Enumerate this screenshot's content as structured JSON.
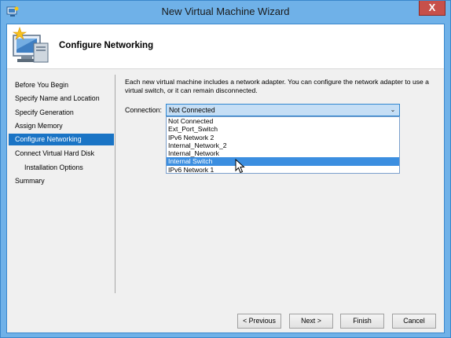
{
  "window": {
    "title": "New Virtual Machine Wizard",
    "close_glyph": "X"
  },
  "header": {
    "title": "Configure Networking",
    "icon": "virtual-machine-wizard-icon"
  },
  "nav": {
    "items": [
      {
        "label": "Before You Begin",
        "active": false,
        "sub": false
      },
      {
        "label": "Specify Name and Location",
        "active": false,
        "sub": false
      },
      {
        "label": "Specify Generation",
        "active": false,
        "sub": false
      },
      {
        "label": "Assign Memory",
        "active": false,
        "sub": false
      },
      {
        "label": "Configure Networking",
        "active": true,
        "sub": false
      },
      {
        "label": "Connect Virtual Hard Disk",
        "active": false,
        "sub": false
      },
      {
        "label": "Installation Options",
        "active": false,
        "sub": true
      },
      {
        "label": "Summary",
        "active": false,
        "sub": false
      }
    ]
  },
  "content": {
    "description": "Each new virtual machine includes a network adapter. You can configure the network adapter to use a virtual switch, or it can remain disconnected.",
    "connection_label": "Connection:",
    "connection_value": "Not Connected",
    "options": [
      {
        "label": "Not Connected",
        "selected": false
      },
      {
        "label": "Ext_Port_Switch",
        "selected": false
      },
      {
        "label": "IPv6 Network 2",
        "selected": false
      },
      {
        "label": "Internal_Network_2",
        "selected": false
      },
      {
        "label": "Internal_Network",
        "selected": false
      },
      {
        "label": "Internal Switch",
        "selected": true
      },
      {
        "label": "IPv6 Network 1",
        "selected": false
      }
    ]
  },
  "buttons": {
    "previous": "< Previous",
    "next": "Next >",
    "finish": "Finish",
    "cancel": "Cancel"
  },
  "colors": {
    "titlebar": "#6fb1e8",
    "accent": "#1a74c5",
    "dropdown_highlight": "#3b8ee0",
    "close": "#c7504a"
  }
}
